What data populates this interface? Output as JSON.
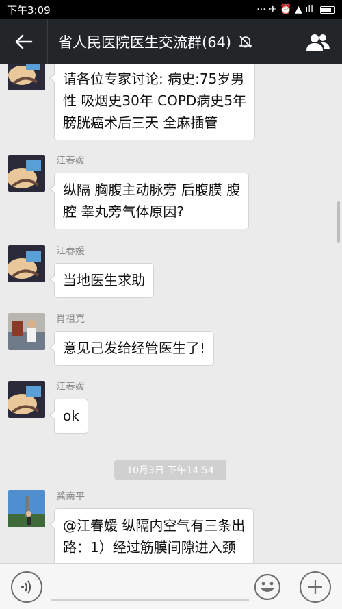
{
  "status_bar": {
    "time": "下午3:09",
    "signal_icons": "··· ✈ ⏰ ▲ ıll"
  },
  "header": {
    "title": "省人民医院医生交流群(64)"
  },
  "messages": [
    {
      "sender": "",
      "lines": [
        "请各位专家讨论: 病史:75岁男",
        "性 吸烟史30年 COPD病史5年",
        "膀胱癌术后三天 全麻插管"
      ]
    },
    {
      "sender": "江春媛",
      "lines": [
        "纵隔 胸腹主动脉旁 后腹膜 腹",
        "腔 睾丸旁气体原因?"
      ]
    },
    {
      "sender": "江春媛",
      "lines": [
        "当地医生求助"
      ]
    },
    {
      "sender": "肖祖克",
      "lines": [
        "意见己发给经管医生了!"
      ]
    },
    {
      "sender": "江春媛",
      "lines": [
        "ok"
      ]
    },
    {
      "sender": "龚南平",
      "lines": [
        "@江春媛 纵隔内空气有三条出",
        "路：1）经过筋膜间隙进入颈"
      ]
    }
  ],
  "time_divider": "10月3日 下午14:54",
  "input": {
    "placeholder": ""
  },
  "icons": {
    "back": "arrow-left",
    "mute": "bell-off",
    "members": "group",
    "voice": "voice-wave",
    "emoji": "smiley",
    "add": "plus"
  },
  "colors": {
    "header_bg": "#232628",
    "chat_bg": "#ebebeb",
    "bubble_bg": "#ffffff"
  }
}
